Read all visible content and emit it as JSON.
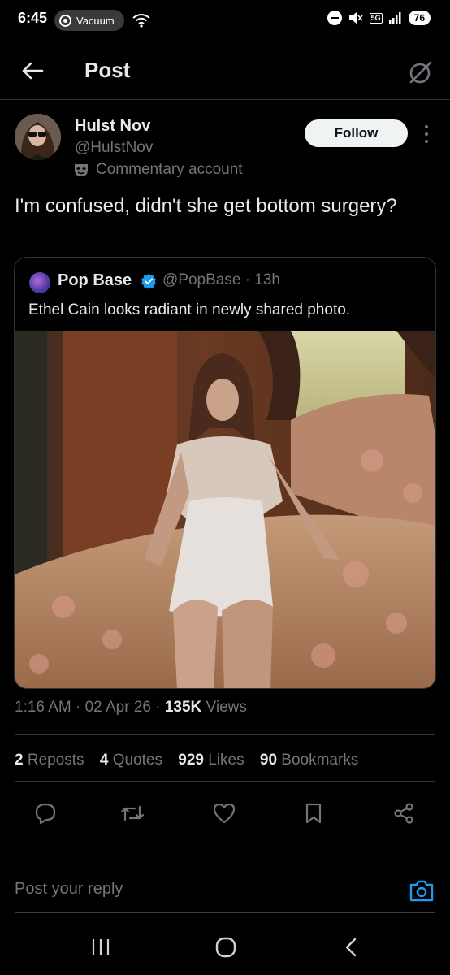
{
  "status_bar": {
    "time": "6:45",
    "pill_label": "Vacuum",
    "network": "5G",
    "battery": "76"
  },
  "header": {
    "back_icon": "arrow-left-icon",
    "title": "Post",
    "grok_icon": "grok-icon"
  },
  "tweet": {
    "author_name": "Hulst Nov",
    "author_handle": "@HulstNov",
    "label_icon": "mask-icon",
    "label": "Commentary account",
    "follow_label": "Follow",
    "text": "I'm confused, didn't she get bottom surgery?",
    "quote": {
      "author_name": "Pop Base",
      "author_handle": "@PopBase",
      "separator": "·",
      "time_ago": "13h",
      "text": "Ethel Cain looks radiant in newly shared photo."
    },
    "meta": {
      "time": "1:16 AM",
      "sep1": "·",
      "date": "02 Apr 26",
      "sep2": "·",
      "views_count": "135K",
      "views_label": "Views"
    },
    "stats": [
      {
        "count": "2",
        "label": "Reposts"
      },
      {
        "count": "4",
        "label": "Quotes"
      },
      {
        "count": "929",
        "label": "Likes"
      },
      {
        "count": "90",
        "label": "Bookmarks"
      }
    ],
    "actions": [
      "reply-icon",
      "repost-icon",
      "like-icon",
      "bookmark-icon",
      "share-icon"
    ]
  },
  "reply": {
    "placeholder": "Post your reply"
  },
  "colors": {
    "background": "#000000",
    "text": "#e7e9ea",
    "secondary": "#71767b",
    "accent": "#1d9bf0",
    "divider": "#2f3336"
  }
}
